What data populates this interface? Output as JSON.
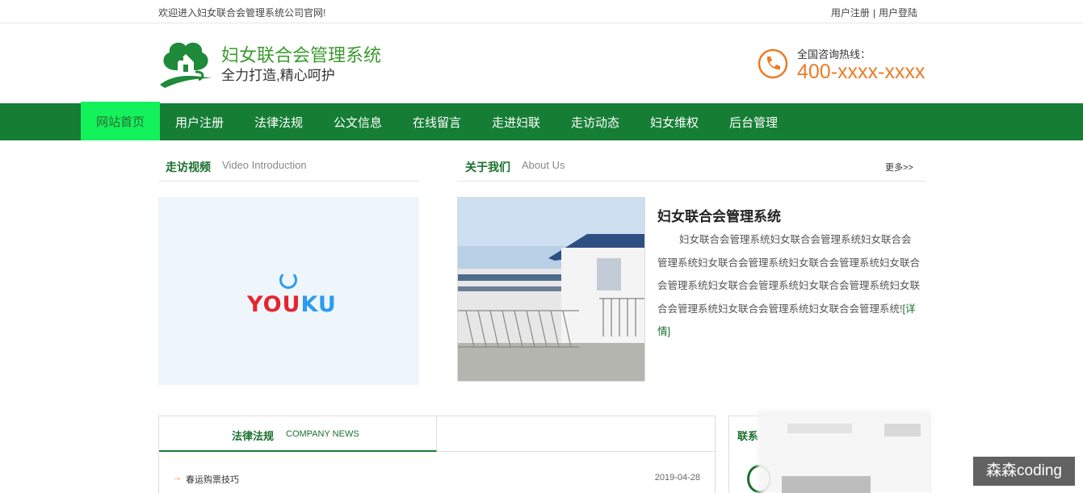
{
  "topbar": {
    "welcome": "欢迎进入妇女联合会管理系统公司官网!",
    "register": "用户注册",
    "separator": "|",
    "login": "用户登陆"
  },
  "header": {
    "title": "妇女联合会管理系统",
    "slogan": "全力打造,精心呵护",
    "hotline_label": "全国咨询热线：",
    "hotline_number": "400-xxxx-xxxx"
  },
  "nav": {
    "items": [
      "网站首页",
      "用户注册",
      "法律法规",
      "公文信息",
      "在线留言",
      "走进妇联",
      "走访动态",
      "妇女维权",
      "后台管理"
    ],
    "active_index": 0
  },
  "video_section": {
    "title": "走访视频",
    "subtitle": "Video Introduction",
    "player_logo": "YOUKU"
  },
  "about_section": {
    "title": "关于我们",
    "subtitle": "About Us",
    "more": "更多>>",
    "heading": "妇女联合会管理系统",
    "body": "妇女联合会管理系统妇女联合会管理系统妇女联合会管理系统妇女联合会管理系统妇女联合会管理系统妇女联合会管理系统妇女联合会管理系统妇女联合会管理系统妇女联合会管理系统妇女联合会管理系统妇女联合会管理系统!",
    "detail_link": "[详情]"
  },
  "news_section": {
    "tab_title": "法律法规",
    "tab_subtitle": "COMPANY NEWS",
    "items": [
      {
        "title": "春运购票技巧",
        "date": "2019-04-28"
      }
    ]
  },
  "contact_section": {
    "title": "联系"
  },
  "watermark": "森森coding",
  "colors": {
    "brand_green": "#167d35",
    "active_nav": "#14f25b",
    "accent_orange": "#ee7a26",
    "title_green": "#3b9a2e"
  }
}
